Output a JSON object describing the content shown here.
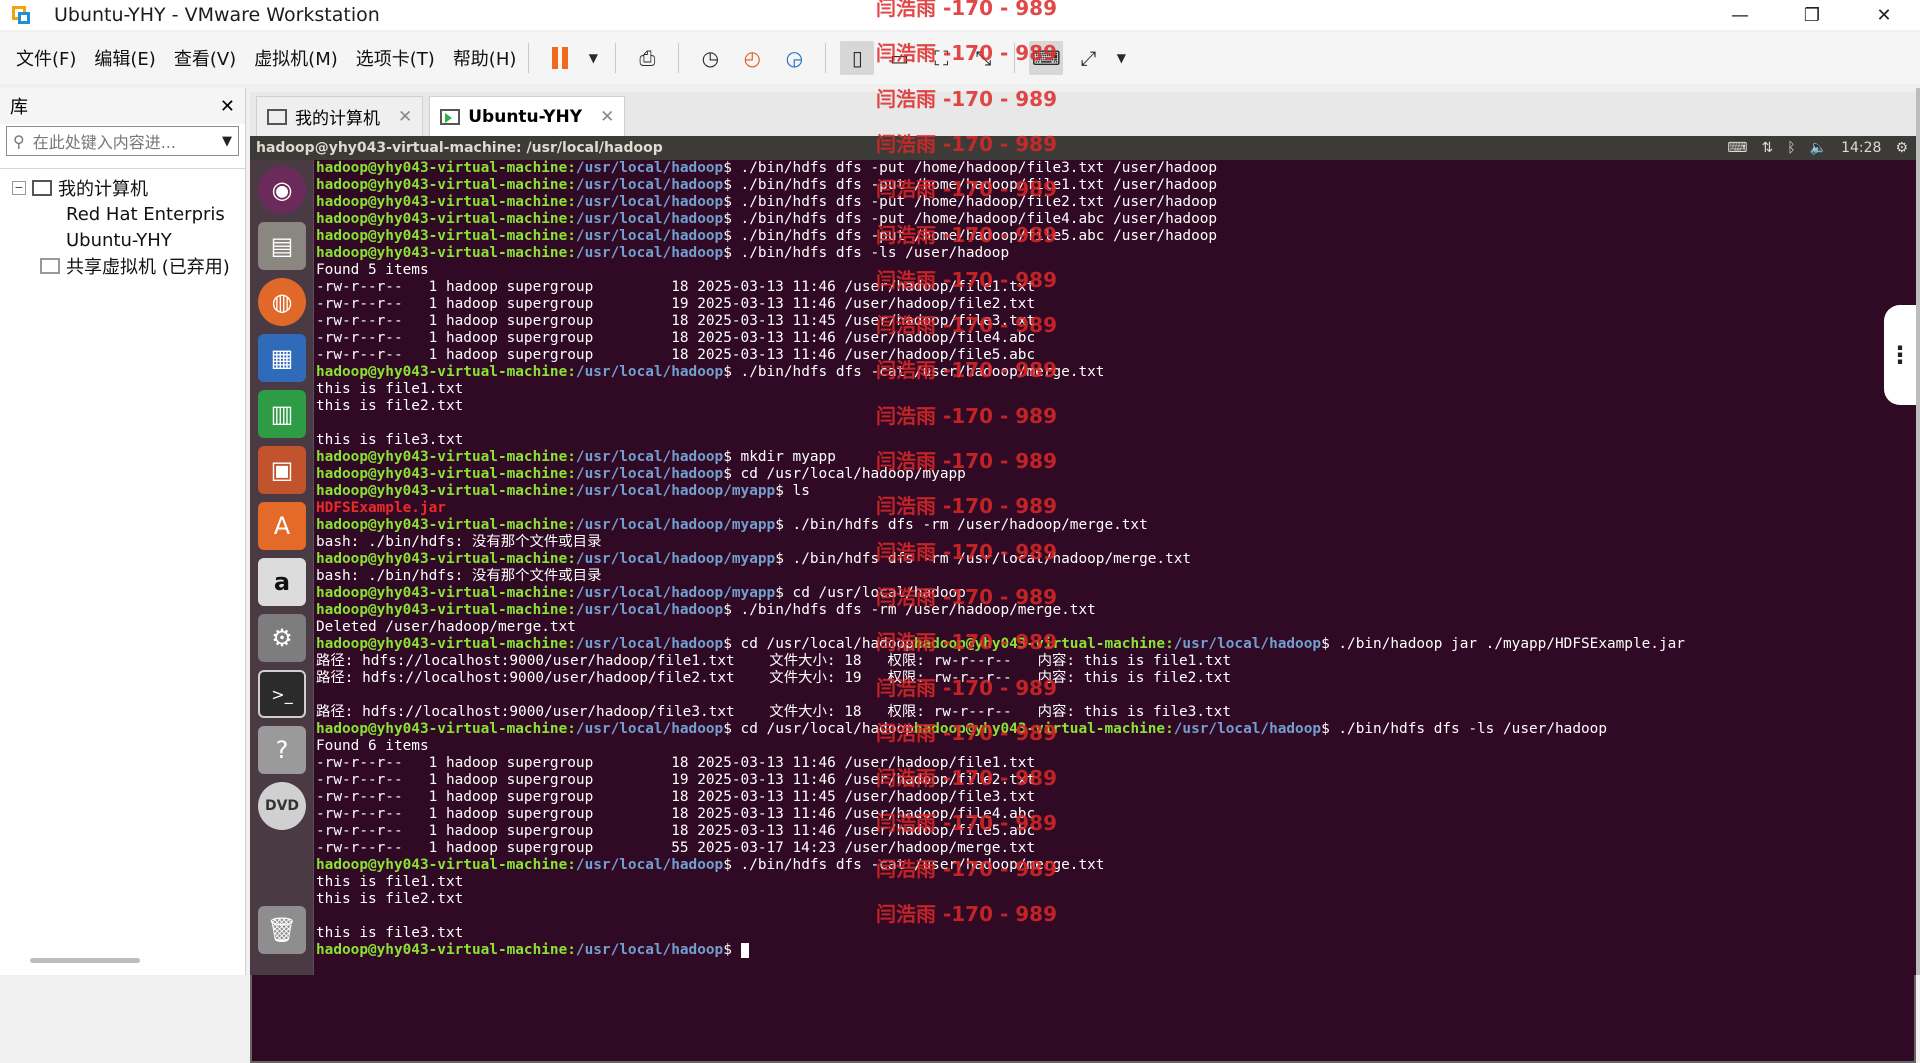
{
  "window": {
    "title": "Ubuntu-YHY - VMware Workstation",
    "controls": [
      "—",
      "❐",
      "✕"
    ]
  },
  "menu": [
    "文件(F)",
    "编辑(E)",
    "查看(V)",
    "虚拟机(M)",
    "选项卡(T)",
    "帮助(H)"
  ],
  "library": {
    "header": "库",
    "close": "✕",
    "search_placeholder": "在此处键入内容进...",
    "tree": {
      "root": "我的计算机",
      "items": [
        "Red Hat Enterpris",
        "Ubuntu-YHY"
      ],
      "shared": "共享虚拟机 (已弃用)"
    }
  },
  "tabs": [
    {
      "label": "我的计算机",
      "close": "✕"
    },
    {
      "label": "Ubuntu-YHY",
      "close": "✕"
    }
  ],
  "ubuntu_bar": {
    "window_title": "hadoop@yhy043-virtual-machine: /usr/local/hadoop",
    "time": "14:28"
  },
  "prompt_user": "hadoop@yhy043-virtual-machine",
  "terminal_lines": [
    {
      "t": "p",
      "path": "/usr/local/hadoop",
      "cmd": " ./bin/hdfs dfs -put /home/hadoop/file3.txt /user/hadoop"
    },
    {
      "t": "p",
      "path": "/usr/local/hadoop",
      "cmd": " ./bin/hdfs dfs -put /home/hadoop/file1.txt /user/hadoop"
    },
    {
      "t": "p",
      "path": "/usr/local/hadoop",
      "cmd": " ./bin/hdfs dfs -put /home/hadoop/file2.txt /user/hadoop"
    },
    {
      "t": "p",
      "path": "/usr/local/hadoop",
      "cmd": " ./bin/hdfs dfs -put /home/hadoop/file4.abc /user/hadoop"
    },
    {
      "t": "p",
      "path": "/usr/local/hadoop",
      "cmd": " ./bin/hdfs dfs -put /home/hadoop/file5.abc /user/hadoop"
    },
    {
      "t": "p",
      "path": "/usr/local/hadoop",
      "cmd": " ./bin/hdfs dfs -ls /user/hadoop"
    },
    {
      "t": "o",
      "text": "Found 5 items"
    },
    {
      "t": "o",
      "text": "-rw-r--r--   1 hadoop supergroup         18 2025-03-13 11:46 /user/hadoop/file1.txt"
    },
    {
      "t": "o",
      "text": "-rw-r--r--   1 hadoop supergroup         19 2025-03-13 11:46 /user/hadoop/file2.txt"
    },
    {
      "t": "o",
      "text": "-rw-r--r--   1 hadoop supergroup         18 2025-03-13 11:45 /user/hadoop/file3.txt"
    },
    {
      "t": "o",
      "text": "-rw-r--r--   1 hadoop supergroup         18 2025-03-13 11:46 /user/hadoop/file4.abc"
    },
    {
      "t": "o",
      "text": "-rw-r--r--   1 hadoop supergroup         18 2025-03-13 11:46 /user/hadoop/file5.abc"
    },
    {
      "t": "p",
      "path": "/usr/local/hadoop",
      "cmd": " ./bin/hdfs dfs -cat /user/hadoop/merge.txt"
    },
    {
      "t": "o",
      "text": "this is file1.txt"
    },
    {
      "t": "o",
      "text": "this is file2.txt"
    },
    {
      "t": "o",
      "text": ""
    },
    {
      "t": "o",
      "text": "this is file3.txt"
    },
    {
      "t": "p",
      "path": "/usr/local/hadoop",
      "cmd": " mkdir myapp"
    },
    {
      "t": "p",
      "path": "/usr/local/hadoop",
      "cmd": " cd /usr/local/hadoop/myapp"
    },
    {
      "t": "p",
      "path": "/usr/local/hadoop/myapp",
      "cmd": " ls"
    },
    {
      "t": "r",
      "text": "HDFSExample.jar"
    },
    {
      "t": "p",
      "path": "/usr/local/hadoop/myapp",
      "cmd": " ./bin/hdfs dfs -rm /user/hadoop/merge.txt"
    },
    {
      "t": "o",
      "text": "bash: ./bin/hdfs: 没有那个文件或目录"
    },
    {
      "t": "p",
      "path": "/usr/local/hadoop/myapp",
      "cmd": " ./bin/hdfs dfs -rm /usr/local/hadoop/merge.txt"
    },
    {
      "t": "o",
      "text": "bash: ./bin/hdfs: 没有那个文件或目录"
    },
    {
      "t": "p",
      "path": "/usr/local/hadoop/myapp",
      "cmd": " cd /usr/local/hadoop"
    },
    {
      "t": "p",
      "path": "/usr/local/hadoop",
      "cmd": " ./bin/hdfs dfs -rm /user/hadoop/merge.txt"
    },
    {
      "t": "o",
      "text": "Deleted /user/hadoop/merge.txt"
    },
    {
      "t": "p2",
      "path": "/usr/local/hadoop",
      "cmd": " cd /usr/local/hadoop",
      "path2": "/usr/local/hadoop",
      "cmd2": " ./bin/hadoop jar ./myapp/HDFSExample.jar"
    },
    {
      "t": "o",
      "text": "路径: hdfs://localhost:9000/user/hadoop/file1.txt    文件大小: 18   权限: rw-r--r--   内容: this is file1.txt"
    },
    {
      "t": "o",
      "text": "路径: hdfs://localhost:9000/user/hadoop/file2.txt    文件大小: 19   权限: rw-r--r--   内容: this is file2.txt"
    },
    {
      "t": "o",
      "text": ""
    },
    {
      "t": "o",
      "text": "路径: hdfs://localhost:9000/user/hadoop/file3.txt    文件大小: 18   权限: rw-r--r--   内容: this is file3.txt"
    },
    {
      "t": "p2",
      "path": "/usr/local/hadoop",
      "cmd": " cd /usr/local/hadoop",
      "path2": "/usr/local/hadoop",
      "cmd2": " ./bin/hdfs dfs -ls /user/hadoop"
    },
    {
      "t": "o",
      "text": "Found 6 items"
    },
    {
      "t": "o",
      "text": "-rw-r--r--   1 hadoop supergroup         18 2025-03-13 11:46 /user/hadoop/file1.txt"
    },
    {
      "t": "o",
      "text": "-rw-r--r--   1 hadoop supergroup         19 2025-03-13 11:46 /user/hadoop/file2.txt"
    },
    {
      "t": "o",
      "text": "-rw-r--r--   1 hadoop supergroup         18 2025-03-13 11:45 /user/hadoop/file3.txt"
    },
    {
      "t": "o",
      "text": "-rw-r--r--   1 hadoop supergroup         18 2025-03-13 11:46 /user/hadoop/file4.abc"
    },
    {
      "t": "o",
      "text": "-rw-r--r--   1 hadoop supergroup         18 2025-03-13 11:46 /user/hadoop/file5.abc"
    },
    {
      "t": "o",
      "text": "-rw-r--r--   1 hadoop supergroup         55 2025-03-17 14:23 /user/hadoop/merge.txt"
    },
    {
      "t": "p",
      "path": "/usr/local/hadoop",
      "cmd": " ./bin/hdfs dfs -cat /user/hadoop/merge.txt"
    },
    {
      "t": "o",
      "text": "this is file1.txt"
    },
    {
      "t": "o",
      "text": "this is file2.txt"
    },
    {
      "t": "o",
      "text": ""
    },
    {
      "t": "o",
      "text": "this is file3.txt"
    },
    {
      "t": "c",
      "path": "/usr/local/hadoop"
    }
  ],
  "watermark": "闫浩雨 -170 - 989",
  "colors": {
    "terminal_bg": "#300a24",
    "prompt_user": "#8ae234",
    "prompt_path": "#729fcf",
    "launcher_bg": "#4a3a44",
    "pause_accent": "#f06a1d"
  }
}
